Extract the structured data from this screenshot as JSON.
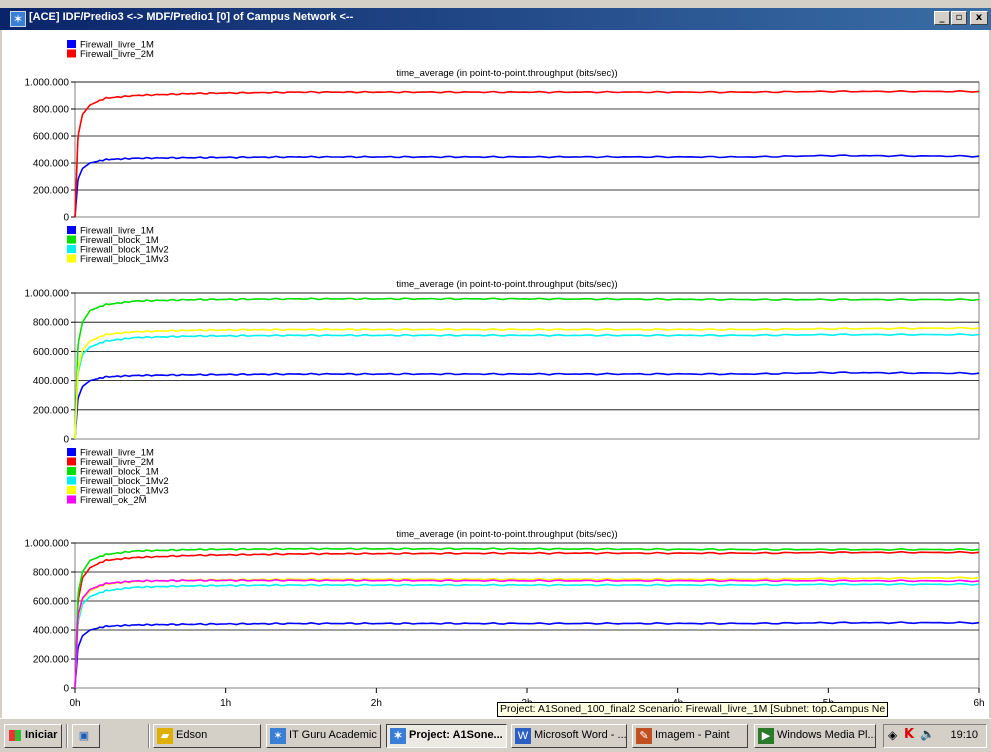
{
  "window": {
    "title": "[ACE] IDF/Predio3 <-> MDF/Predio1 [0] of Campus Network <--",
    "title_icon": "opnet-star-icon",
    "buttons": {
      "minimize": "_",
      "restore": "▫",
      "close": "x"
    }
  },
  "colors": {
    "Firewall_livre_1M": "#0000ff",
    "Firewall_livre_2M": "#ff0000",
    "Firewall_block_1M": "#00e000",
    "Firewall_block_1Mv2": "#00f0f0",
    "Firewall_block_1Mv3": "#ffff00",
    "Firewall_ok_2M": "#ff00ff"
  },
  "chart_data": [
    {
      "type": "line",
      "title": "time_average (in point-to-point.throughput (bits/sec))",
      "xlim": [
        0,
        6
      ],
      "ylim": [
        0,
        1000000
      ],
      "yticks": [
        "0",
        "200.000",
        "400.000",
        "600.000",
        "800.000",
        "1.000.000"
      ],
      "grid": true,
      "legend_position": "top-left",
      "series": [
        {
          "name": "Firewall_livre_1M",
          "color": "#0000ff",
          "x": [
            0,
            0.02,
            0.05,
            0.1,
            0.2,
            0.4,
            0.8,
            1.5,
            3,
            4.5,
            5,
            6
          ],
          "y": [
            0,
            280000,
            360000,
            400000,
            425000,
            435000,
            440000,
            445000,
            445000,
            445000,
            455000,
            450000
          ]
        },
        {
          "name": "Firewall_livre_2M",
          "color": "#ff0000",
          "x": [
            0,
            0.02,
            0.05,
            0.1,
            0.2,
            0.4,
            0.8,
            1.5,
            3,
            4.5,
            5,
            6
          ],
          "y": [
            0,
            600000,
            760000,
            830000,
            880000,
            900000,
            915000,
            925000,
            925000,
            925000,
            930000,
            930000
          ]
        }
      ]
    },
    {
      "type": "line",
      "title": "time_average (in point-to-point.throughput (bits/sec))",
      "xlim": [
        0,
        6
      ],
      "ylim": [
        0,
        1000000
      ],
      "yticks": [
        "0",
        "200.000",
        "400.000",
        "600.000",
        "800.000",
        "1.000.000"
      ],
      "grid": true,
      "legend_position": "top-left",
      "series": [
        {
          "name": "Firewall_livre_1M",
          "color": "#0000ff",
          "x": [
            0,
            0.02,
            0.05,
            0.1,
            0.2,
            0.4,
            0.8,
            1.5,
            3,
            4.5,
            5,
            6
          ],
          "y": [
            0,
            280000,
            360000,
            400000,
            425000,
            435000,
            440000,
            445000,
            445000,
            445000,
            455000,
            450000
          ]
        },
        {
          "name": "Firewall_block_1M",
          "color": "#00e000",
          "x": [
            0,
            0.02,
            0.05,
            0.1,
            0.2,
            0.4,
            0.8,
            1.5,
            3,
            4.5,
            5,
            6
          ],
          "y": [
            0,
            650000,
            800000,
            880000,
            920000,
            945000,
            955000,
            960000,
            960000,
            955000,
            955000,
            955000
          ]
        },
        {
          "name": "Firewall_block_1Mv2",
          "color": "#00f0f0",
          "x": [
            0,
            0.02,
            0.05,
            0.1,
            0.2,
            0.4,
            0.8,
            1.5,
            3,
            4.5,
            5,
            6
          ],
          "y": [
            0,
            450000,
            580000,
            630000,
            670000,
            695000,
            705000,
            710000,
            710000,
            710000,
            715000,
            715000
          ]
        },
        {
          "name": "Firewall_block_1Mv3",
          "color": "#ffff00",
          "x": [
            0,
            0.02,
            0.05,
            0.1,
            0.2,
            0.4,
            0.8,
            1.5,
            3,
            4.5,
            5,
            6
          ],
          "y": [
            0,
            480000,
            610000,
            670000,
            715000,
            735000,
            745000,
            750000,
            750000,
            750000,
            755000,
            760000
          ]
        }
      ]
    },
    {
      "type": "line",
      "title": "time_average (in point-to-point.throughput (bits/sec))",
      "xlim": [
        0,
        6
      ],
      "ylim": [
        0,
        1000000
      ],
      "xticks": [
        "0h",
        "1h",
        "2h",
        "3h",
        "4h",
        "5h",
        "6h"
      ],
      "yticks": [
        "0",
        "200.000",
        "400.000",
        "600.000",
        "800.000",
        "1.000.000"
      ],
      "grid": true,
      "legend_position": "top-left",
      "series": [
        {
          "name": "Firewall_livre_1M",
          "color": "#0000ff",
          "x": [
            0,
            0.02,
            0.05,
            0.1,
            0.2,
            0.4,
            0.8,
            1.5,
            3,
            4.5,
            5,
            6
          ],
          "y": [
            0,
            280000,
            360000,
            400000,
            425000,
            435000,
            440000,
            445000,
            445000,
            445000,
            450000,
            450000
          ]
        },
        {
          "name": "Firewall_livre_2M",
          "color": "#ff0000",
          "x": [
            0,
            0.02,
            0.05,
            0.1,
            0.2,
            0.4,
            0.8,
            1.5,
            3,
            4.5,
            5,
            6
          ],
          "y": [
            0,
            600000,
            760000,
            830000,
            880000,
            900000,
            915000,
            925000,
            930000,
            930000,
            935000,
            935000
          ]
        },
        {
          "name": "Firewall_block_1M",
          "color": "#00e000",
          "x": [
            0,
            0.02,
            0.05,
            0.1,
            0.2,
            0.4,
            0.8,
            1.5,
            3,
            4.5,
            5,
            6
          ],
          "y": [
            0,
            650000,
            800000,
            880000,
            920000,
            945000,
            955000,
            960000,
            960000,
            955000,
            955000,
            955000
          ]
        },
        {
          "name": "Firewall_block_1Mv2",
          "color": "#00f0f0",
          "x": [
            0,
            0.02,
            0.05,
            0.1,
            0.2,
            0.4,
            0.8,
            1.5,
            3,
            4.5,
            5,
            6
          ],
          "y": [
            0,
            450000,
            580000,
            630000,
            670000,
            695000,
            705000,
            710000,
            710000,
            710000,
            715000,
            715000
          ]
        },
        {
          "name": "Firewall_block_1Mv3",
          "color": "#ffff00",
          "x": [
            0,
            0.02,
            0.05,
            0.1,
            0.2,
            0.4,
            0.8,
            1.5,
            3,
            4.5,
            5,
            6
          ],
          "y": [
            0,
            480000,
            610000,
            670000,
            715000,
            735000,
            745000,
            750000,
            750000,
            750000,
            755000,
            760000
          ]
        },
        {
          "name": "Firewall_ok_2M",
          "color": "#ff00ff",
          "x": [
            0,
            0.02,
            0.05,
            0.1,
            0.2,
            0.4,
            0.8,
            1.5,
            3,
            4.5,
            5,
            6
          ],
          "y": [
            0,
            500000,
            620000,
            680000,
            720000,
            738000,
            742000,
            742000,
            740000,
            740000,
            740000,
            738000
          ]
        }
      ]
    }
  ],
  "tooltip": "Project: A1Soned_100_final2 Scenario: Firewall_livre_1M  [Subnet: top.Campus Ne",
  "taskbar": {
    "start_label": "Iniciar",
    "buttons": [
      {
        "label": "Edson",
        "icon": "folder-icon",
        "active": false
      },
      {
        "label": "IT Guru Academic ...",
        "icon": "opnet-star-icon",
        "active": false
      },
      {
        "label": "Project: A1Sone...",
        "icon": "opnet-star-icon",
        "active": true
      },
      {
        "label": "Microsoft Word - ...",
        "icon": "word-icon",
        "active": false
      },
      {
        "label": "Imagem - Paint",
        "icon": "paint-icon",
        "active": false
      },
      {
        "label": "Windows Media Pl...",
        "icon": "media-player-icon",
        "active": false
      }
    ],
    "clock": "19:10"
  }
}
